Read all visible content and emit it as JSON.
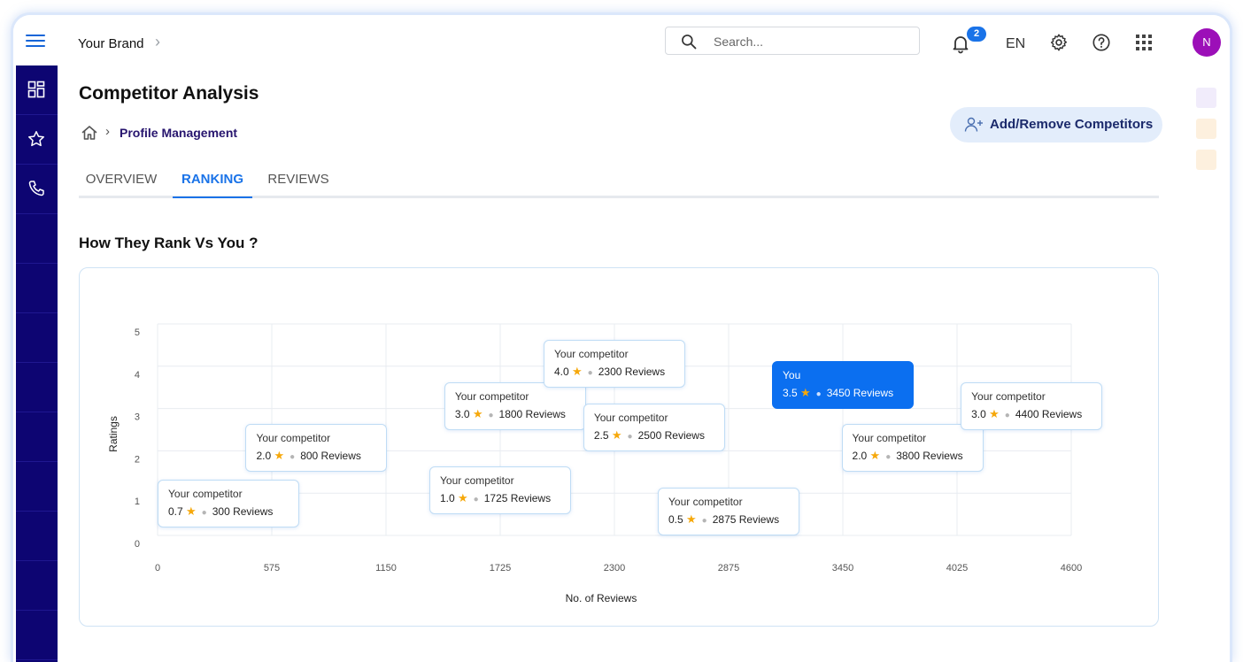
{
  "header": {
    "brand": "Your Brand",
    "search_placeholder": "Search...",
    "notification_count": "2",
    "language": "EN",
    "avatar_initial": "N"
  },
  "sidebar": {
    "items": [
      {
        "icon": "dashboard-icon"
      },
      {
        "icon": "star-icon"
      },
      {
        "icon": "phone-icon"
      }
    ]
  },
  "page": {
    "title": "Competitor Analysis",
    "breadcrumb": "Profile Management",
    "add_button": "Add/Remove Competitors",
    "tabs": [
      {
        "label": "OVERVIEW",
        "active": false
      },
      {
        "label": "RANKING",
        "active": true
      },
      {
        "label": "REVIEWS",
        "active": false
      }
    ],
    "section_title": "How They Rank Vs You ?"
  },
  "colors": {
    "sidebar": "#0d0572",
    "accent": "#1a73e8",
    "you_card": "#0b6ff0",
    "star": "#f6a80a",
    "rail": [
      "#f1ecfb",
      "#fdf0de",
      "#fdf0de"
    ]
  },
  "chart_data": {
    "type": "scatter",
    "xlabel": "No. of Reviews",
    "ylabel": "Ratings",
    "xlim": [
      0,
      4600
    ],
    "ylim": [
      0,
      5
    ],
    "x_ticks": [
      "0",
      "575",
      "1150",
      "1725",
      "2300",
      "2875",
      "3450",
      "4025",
      "4600"
    ],
    "y_ticks": [
      "0",
      "1",
      "2",
      "3",
      "4",
      "5"
    ],
    "grid": true,
    "points": [
      {
        "name": "Your competitor",
        "rating": "0.7",
        "reviews": "300 Reviews",
        "x": 300,
        "y": 0.7,
        "you": false
      },
      {
        "name": "Your competitor",
        "rating": "2.0",
        "reviews": "800 Reviews",
        "x": 800,
        "y": 2.0,
        "you": false
      },
      {
        "name": "Your competitor",
        "rating": "1.0",
        "reviews": "1725 Reviews",
        "x": 1725,
        "y": 1.0,
        "you": false
      },
      {
        "name": "Your competitor",
        "rating": "3.0",
        "reviews": "1800 Reviews",
        "x": 1800,
        "y": 3.0,
        "you": false
      },
      {
        "name": "Your competitor",
        "rating": "4.0",
        "reviews": "2300 Reviews",
        "x": 2300,
        "y": 4.0,
        "you": false
      },
      {
        "name": "Your competitor",
        "rating": "2.5",
        "reviews": "2500 Reviews",
        "x": 2500,
        "y": 2.5,
        "you": false
      },
      {
        "name": "Your competitor",
        "rating": "0.5",
        "reviews": "2875 Reviews",
        "x": 2875,
        "y": 0.5,
        "you": false
      },
      {
        "name": "You",
        "rating": "3.5",
        "reviews": "3450 Reviews",
        "x": 3450,
        "y": 3.5,
        "you": true
      },
      {
        "name": "Your competitor",
        "rating": "2.0",
        "reviews": "3800 Reviews",
        "x": 3800,
        "y": 2.0,
        "you": false
      },
      {
        "name": "Your competitor",
        "rating": "3.0",
        "reviews": "4400 Reviews",
        "x": 4400,
        "y": 3.0,
        "you": false
      }
    ]
  }
}
